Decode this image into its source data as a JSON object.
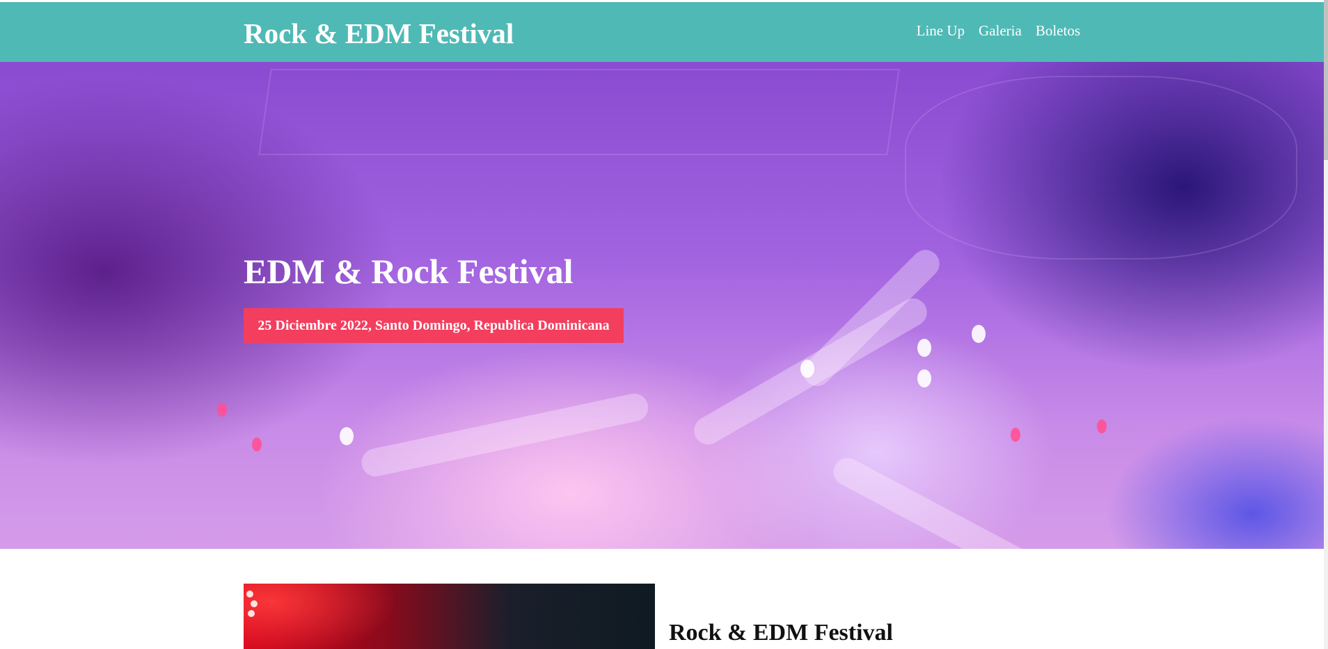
{
  "header": {
    "site_title": "Rock & EDM Festival",
    "nav": [
      "Line Up",
      "Galeria",
      "Boletos"
    ],
    "background_color": "#4fb9b5"
  },
  "hero": {
    "title": "EDM & Rock Festival",
    "date_location": "25 Diciembre 2022, Santo Domingo, Republica Dominicana",
    "badge_color": "#f33e5e"
  },
  "content": {
    "title": "Rock & EDM Festival"
  }
}
